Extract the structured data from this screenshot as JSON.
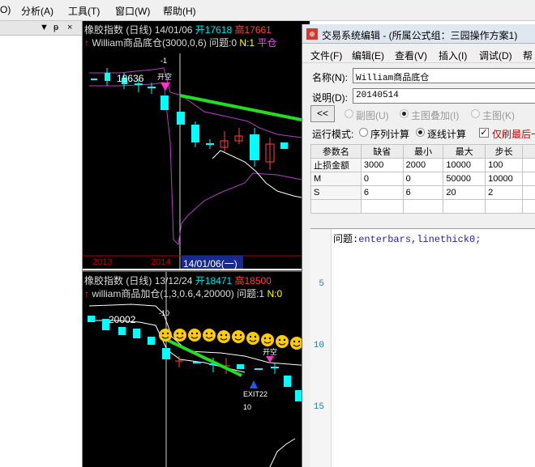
{
  "menubar": {
    "items": [
      "O)",
      "分析(A)",
      "工具(T)",
      "窗口(W)",
      "帮助(H)"
    ]
  },
  "left_panel": {
    "controls": [
      "▼",
      "ᵽ",
      "×"
    ]
  },
  "chart1": {
    "instrument": "橡胶指数",
    "period": "(日线)",
    "date": "14/01/06",
    "open_label": "开17618",
    "high_label": "高17661",
    "formula_name": "William商品底仓(3000,0,6)",
    "question": "问题:0",
    "n_label": "N:1",
    "ping_label": "平仓",
    "price_label": "18636",
    "level_label": "-1",
    "signal_label": "开空",
    "year_labels": [
      "2013",
      "2014"
    ],
    "cursor_date": "14/01/06(一)"
  },
  "chart2": {
    "instrument": "橡胶指数",
    "period": "(日线)",
    "date": "13/12/24",
    "open_label": "开18471",
    "high_label": "高18500",
    "formula_name": "william商品加仓(1,3,0.6,4,20000)",
    "question": "问题:1",
    "n_label": "N:0",
    "price_label": "20002",
    "level_label": "-10",
    "signal_label": "开空",
    "exit_label": "EXIT22",
    "exit_value": "10"
  },
  "editor": {
    "title": "交易系统编辑 - (所属公式组：三园操作方案1)",
    "menu": [
      "文件(F)",
      "编辑(E)",
      "查看(V)",
      "插入(I)",
      "调试(D)",
      "帮"
    ],
    "name_label": "名称(N):",
    "name_value": "William商品底仓",
    "desc_label": "说明(D):",
    "desc_value": "20140514",
    "back_button": "<<",
    "radio_sub": "副图(U)",
    "radio_overlay": "主图叠加(I)",
    "radio_main": "主图(K)",
    "run_mode_label": "运行模式:",
    "run_seq": "序列计算",
    "run_bar": "逐线计算",
    "refresh_last": "仅刷最后一",
    "grid": {
      "headers": [
        "参数名",
        "缺省",
        "最小",
        "最大",
        "步长"
      ],
      "rows": [
        [
          "止损金额",
          "3000",
          "2000",
          "10000",
          "100"
        ],
        [
          "M",
          "0",
          "0",
          "50000",
          "10000"
        ],
        [
          "S",
          "6",
          "6",
          "20",
          "2"
        ],
        [
          "",
          "",
          "",
          "",
          ""
        ]
      ]
    },
    "code": {
      "line_numbers": [
        "5",
        "10",
        "15"
      ],
      "text_prefix": "问题:",
      "text_func": "enterbars,linethick0;"
    }
  }
}
